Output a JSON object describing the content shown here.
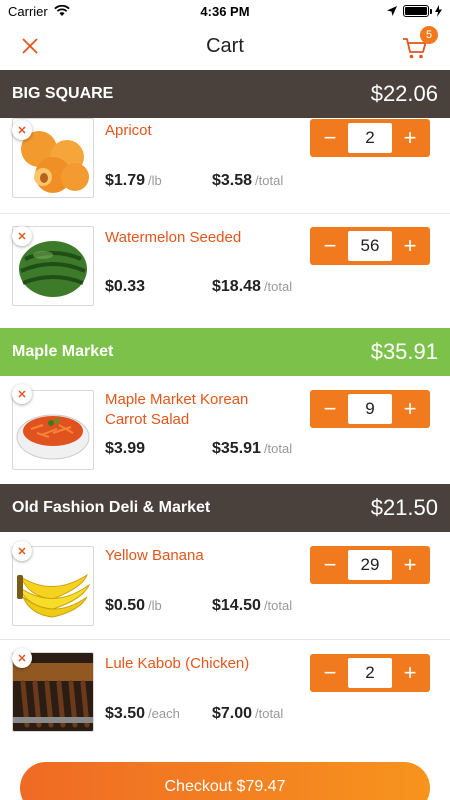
{
  "status": {
    "carrier": "Carrier",
    "time": "4:36 PM"
  },
  "nav": {
    "title": "Cart",
    "cart_count": "5"
  },
  "stores": [
    {
      "name": "BIG SQUARE",
      "total": "$22.06",
      "items": [
        {
          "name": "Apricot",
          "price": "$1.79",
          "price_unit": "/lb",
          "total": "$3.58",
          "total_unit": "/total",
          "qty": "2"
        },
        {
          "name": "Watermelon Seeded",
          "price": "$0.33",
          "price_unit": "",
          "total": "$18.48",
          "total_unit": "/total",
          "qty": "56"
        }
      ]
    },
    {
      "name": "Maple Market",
      "total": "$35.91",
      "items": [
        {
          "name": "Maple Market Korean Carrot Salad",
          "price": "$3.99",
          "price_unit": "",
          "total": "$35.91",
          "total_unit": "/total",
          "qty": "9"
        }
      ]
    },
    {
      "name": "Old Fashion Deli & Market",
      "total": "$21.50",
      "items": [
        {
          "name": "Yellow Banana",
          "price": "$0.50",
          "price_unit": "/lb",
          "total": "$14.50",
          "total_unit": "/total",
          "qty": "29"
        },
        {
          "name": "Lule Kabob (Chicken)",
          "price": "$3.50",
          "price_unit": "/each",
          "total": "$7.00",
          "total_unit": "/total",
          "qty": "2"
        }
      ]
    }
  ],
  "checkout": {
    "label": "Checkout $79.47"
  },
  "colors": {
    "accent": "#f07a1d",
    "item_name": "#e2561c",
    "store_dark": "#4a403c",
    "store_green": "#7cc14a"
  }
}
